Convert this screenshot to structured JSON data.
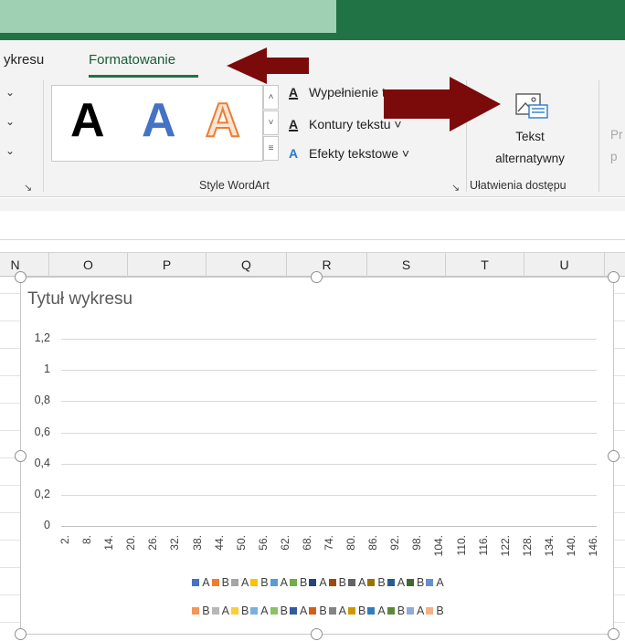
{
  "ribbon": {
    "tabs": [
      {
        "label": "ykresu"
      },
      {
        "label": "Formatowanie",
        "active": true
      }
    ],
    "dropdown_stubs": [
      "⌄",
      "⌄",
      "⌄"
    ],
    "wordart_samples": [
      "A",
      "A",
      "A"
    ],
    "gallery_scroll": [
      "˄",
      "˅",
      "≡"
    ],
    "text_format": [
      {
        "icon": "A",
        "label": "Wypełnienie te"
      },
      {
        "icon": "A",
        "label": "Kontury tekstu ˅"
      },
      {
        "icon": "A",
        "label": "Efekty tekstowe ˅"
      }
    ],
    "group_wordart_label": "Style WordArt",
    "alt_text_line1": "Tekst",
    "alt_text_line2": "alternatywny",
    "group_access_label": "Ułatwienia dostępu",
    "next_group_line1": "Pr",
    "next_group_line2": "p",
    "launcher_glyph": "↘"
  },
  "columns": [
    "N",
    "O",
    "P",
    "Q",
    "R",
    "S",
    "T",
    "U"
  ],
  "chart_data": {
    "type": "bar",
    "title": "Tytuł wykresu",
    "yticks": [
      "1,2",
      "1",
      "0,8",
      "0,6",
      "0,4",
      "0,2",
      "0"
    ],
    "ylim": [
      0,
      1.2
    ],
    "categories": [
      "2.",
      "8.",
      "14.",
      "20.",
      "26.",
      "32.",
      "38.",
      "44.",
      "50.",
      "56.",
      "62.",
      "68.",
      "74.",
      "80.",
      "86.",
      "92.",
      "98.",
      "104.",
      "110.",
      "116.",
      "122.",
      "128.",
      "134.",
      "140.",
      "146."
    ],
    "series": [],
    "legend_row1": [
      {
        "label": "A",
        "color": "#4472c4"
      },
      {
        "label": "B",
        "color": "#ed7d31"
      },
      {
        "label": "A",
        "color": "#a5a5a5"
      },
      {
        "label": "B",
        "color": "#ffc000"
      },
      {
        "label": "A",
        "color": "#5b9bd5"
      },
      {
        "label": "B",
        "color": "#70ad47"
      },
      {
        "label": "A",
        "color": "#264478"
      },
      {
        "label": "B",
        "color": "#9e480e"
      },
      {
        "label": "A",
        "color": "#636363"
      },
      {
        "label": "B",
        "color": "#997300"
      },
      {
        "label": "A",
        "color": "#255e91"
      },
      {
        "label": "B",
        "color": "#43682b"
      },
      {
        "label": "A",
        "color": "#698ed0"
      }
    ],
    "legend_row2": [
      {
        "label": "B",
        "color": "#f1975a"
      },
      {
        "label": "A",
        "color": "#b7b7b7"
      },
      {
        "label": "B",
        "color": "#ffcd33"
      },
      {
        "label": "A",
        "color": "#7cafdd"
      },
      {
        "label": "B",
        "color": "#8cc168"
      },
      {
        "label": "A",
        "color": "#335aa1"
      },
      {
        "label": "B",
        "color": "#d26012"
      },
      {
        "label": "A",
        "color": "#848484"
      },
      {
        "label": "B",
        "color": "#cc9a00"
      },
      {
        "label": "A",
        "color": "#327dc2"
      },
      {
        "label": "B",
        "color": "#5a8a39"
      },
      {
        "label": "A",
        "color": "#8faadc"
      },
      {
        "label": "B",
        "color": "#f4b183"
      }
    ],
    "grid": true,
    "legend_position": "bottom"
  },
  "colors": {
    "excel_green": "#217346",
    "arrow_red": "#7b0a0a"
  }
}
